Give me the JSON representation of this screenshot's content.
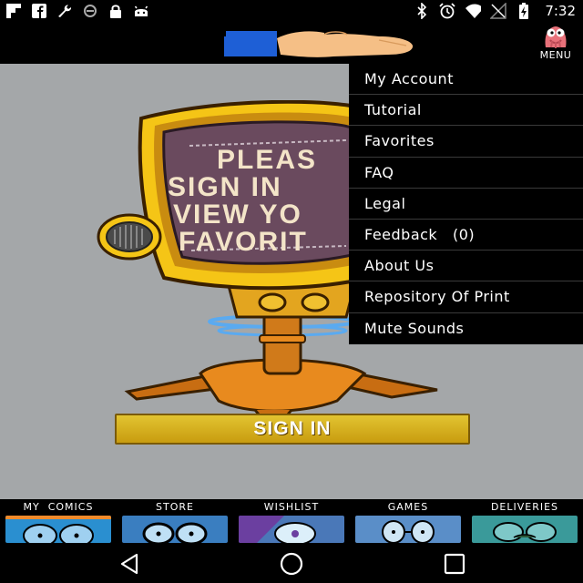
{
  "status_bar": {
    "time": "7:32",
    "left_icons": [
      "flipboard-icon",
      "facebook-icon",
      "wrench-icon",
      "circle-icon",
      "lock-icon",
      "android-icon"
    ],
    "right_icons": [
      "bluetooth-icon",
      "alarm-icon",
      "wifi-icon",
      "no-signal-icon",
      "battery-charging-icon"
    ]
  },
  "header": {
    "menu_label": "MENU"
  },
  "main": {
    "tv_screen_lines": [
      "PLEAS",
      "SIGN IN",
      "VIEW YO",
      "FAVORIT"
    ],
    "sign_in_label": "SIGN IN"
  },
  "menu": {
    "items": [
      "My Account",
      "Tutorial",
      "Favorites",
      "FAQ",
      "Legal",
      "Feedback   (0)",
      "About Us",
      "Repository Of Print",
      "Mute Sounds"
    ]
  },
  "bottom_nav": {
    "tabs": [
      "MY  COMICS",
      "STORE",
      "WISHLIST",
      "GAMES",
      "DELIVERIES"
    ]
  },
  "colors": {
    "accent_yellow": "#e2c431",
    "background_gray": "#a4a7a9",
    "menu_bg": "#000000"
  }
}
